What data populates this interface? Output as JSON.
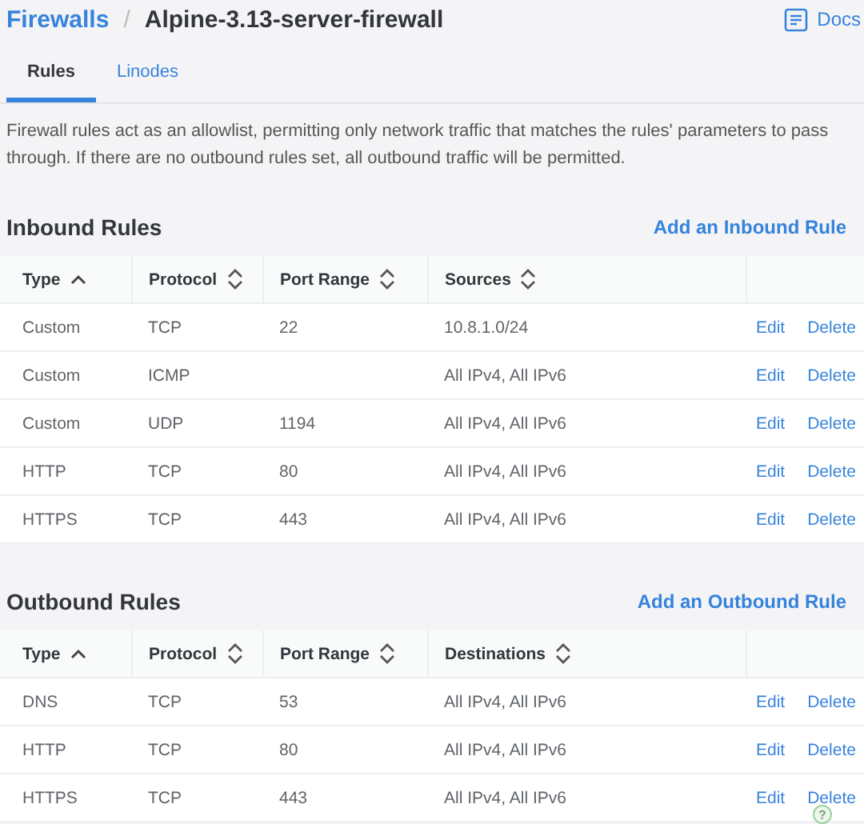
{
  "breadcrumb": {
    "parent": "Firewalls",
    "separator": "/",
    "current": "Alpine-3.13-server-firewall"
  },
  "docs_link": "Docs",
  "tabs": [
    {
      "label": "Rules",
      "selected": true
    },
    {
      "label": "Linodes",
      "selected": false
    }
  ],
  "description": "Firewall rules act as an allowlist, permitting only network traffic that matches the rules' parameters to pass through. If there are no outbound rules set, all outbound traffic will be permitted.",
  "sections": [
    {
      "title": "Inbound Rules",
      "add_button": "Add an Inbound Rule",
      "columns": [
        {
          "label": "Type",
          "sorted": true
        },
        {
          "label": "Protocol",
          "sorted": false
        },
        {
          "label": "Port Range",
          "sorted": false
        },
        {
          "label": "Sources",
          "sorted": false
        }
      ],
      "rows": [
        {
          "cells": [
            "Custom",
            "TCP",
            "22",
            "10.8.1.0/24"
          ],
          "actions": [
            "Edit",
            "Delete"
          ]
        },
        {
          "cells": [
            "Custom",
            "ICMP",
            "",
            "All IPv4, All IPv6"
          ],
          "actions": [
            "Edit",
            "Delete"
          ]
        },
        {
          "cells": [
            "Custom",
            "UDP",
            "1194",
            "All IPv4, All IPv6"
          ],
          "actions": [
            "Edit",
            "Delete"
          ]
        },
        {
          "cells": [
            "HTTP",
            "TCP",
            "80",
            "All IPv4, All IPv6"
          ],
          "actions": [
            "Edit",
            "Delete"
          ]
        },
        {
          "cells": [
            "HTTPS",
            "TCP",
            "443",
            "All IPv4, All IPv6"
          ],
          "actions": [
            "Edit",
            "Delete"
          ]
        }
      ]
    },
    {
      "title": "Outbound Rules",
      "add_button": "Add an Outbound Rule",
      "columns": [
        {
          "label": "Type",
          "sorted": true
        },
        {
          "label": "Protocol",
          "sorted": false
        },
        {
          "label": "Port Range",
          "sorted": false
        },
        {
          "label": "Destinations",
          "sorted": false
        }
      ],
      "rows": [
        {
          "cells": [
            "DNS",
            "TCP",
            "53",
            "All IPv4, All IPv6"
          ],
          "actions": [
            "Edit",
            "Delete"
          ]
        },
        {
          "cells": [
            "HTTP",
            "TCP",
            "80",
            "All IPv4, All IPv6"
          ],
          "actions": [
            "Edit",
            "Delete"
          ]
        },
        {
          "cells": [
            "HTTPS",
            "TCP",
            "443",
            "All IPv4, All IPv6"
          ],
          "actions": [
            "Edit",
            "Delete"
          ]
        }
      ]
    }
  ],
  "help_button": "?"
}
